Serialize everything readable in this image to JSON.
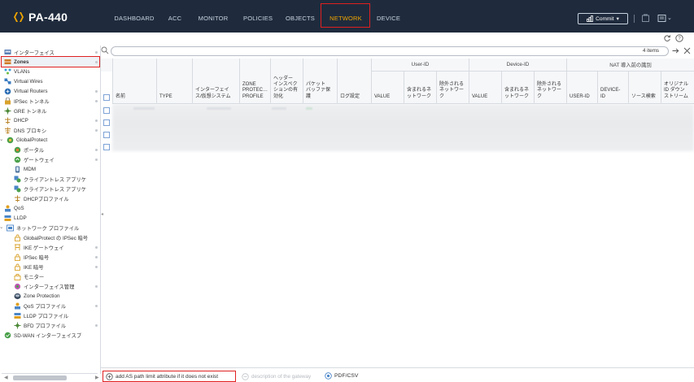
{
  "header": {
    "product": "PA-440",
    "tabs": [
      {
        "label": "DASHBOARD"
      },
      {
        "label": "ACC"
      },
      {
        "label": "MONITOR"
      },
      {
        "label": "POLICIES"
      },
      {
        "label": "OBJECTS"
      },
      {
        "label": "NETWORK",
        "active": true
      },
      {
        "label": "DEVICE"
      }
    ],
    "commit_label": "Commit",
    "active_color": "#f0a500",
    "bar_color": "#1f2b3d"
  },
  "sidebar": {
    "items": [
      {
        "label": "インターフェイス",
        "icon": "interface-icon"
      },
      {
        "label": "Zones",
        "icon": "zone-icon",
        "selected": true
      },
      {
        "label": "VLANs",
        "icon": "vlan-icon"
      },
      {
        "label": "Virtual Wires",
        "icon": "virtual-wire-icon"
      },
      {
        "label": "Virtual Routers",
        "icon": "virtual-router-icon"
      },
      {
        "label": "IPSec トンネル",
        "icon": "ipsec-tunnel-icon"
      },
      {
        "label": "GRE トンネル",
        "icon": "gre-tunnel-icon"
      },
      {
        "label": "DHCP",
        "icon": "dhcp-icon"
      },
      {
        "label": "DNS プロキシ",
        "icon": "dns-proxy-icon"
      },
      {
        "label": "GlobalProtect",
        "icon": "globalprotect-icon",
        "expanded": true
      },
      {
        "label": "ポータル",
        "icon": "portal-icon"
      },
      {
        "label": "ゲートウェイ",
        "icon": "gateway-icon"
      },
      {
        "label": "MDM",
        "icon": "mdm-icon"
      },
      {
        "label": "クライアントレス アプリケ",
        "icon": "clientless-app-icon"
      },
      {
        "label": "クライアントレス アプリケ",
        "icon": "clientless-app-group-icon"
      },
      {
        "label": "DHCPプロファイル",
        "icon": "dhcp-profile-icon"
      },
      {
        "label": "QoS",
        "icon": "qos-icon"
      },
      {
        "label": "LLDP",
        "icon": "lldp-icon"
      },
      {
        "label": "ネットワーク プロファイル",
        "icon": "network-profiles-icon",
        "expanded": true
      },
      {
        "label": "GlobalProtect の IPSec 暗号",
        "icon": "gp-ipsec-crypto-icon"
      },
      {
        "label": "IKE ゲートウェイ",
        "icon": "ike-gateway-icon"
      },
      {
        "label": "IPSec 暗号",
        "icon": "ipsec-crypto-icon"
      },
      {
        "label": "IKE 暗号",
        "icon": "ike-crypto-icon"
      },
      {
        "label": "モニター",
        "icon": "monitor-profile-icon"
      },
      {
        "label": "インターフェイス管理",
        "icon": "interface-mgmt-icon"
      },
      {
        "label": "Zone Protection",
        "icon": "zone-protection-icon"
      },
      {
        "label": "QoS プロファイル",
        "icon": "qos-profile-icon"
      },
      {
        "label": "LLDP プロファイル",
        "icon": "lldp-profile-icon"
      },
      {
        "label": "BFD プロファイル",
        "icon": "bfd-profile-icon"
      },
      {
        "label": "SD-WAN インターフェイスプ",
        "icon": "sdwan-interface-icon"
      }
    ]
  },
  "search": {
    "value": "",
    "placeholder": "",
    "items_count": "4 items"
  },
  "table": {
    "group_headers": {
      "user_id": "User-ID",
      "device_id": "Device-ID",
      "nat": "NAT 導入前の識別"
    },
    "columns": {
      "name": "名前",
      "type": "TYPE",
      "interfaces": [
        "インターフェイ",
        "ス/仮想システム"
      ],
      "zone_protection": [
        "ZONE",
        "PROTEC…",
        "PROFILE"
      ],
      "header_inspection": [
        "ヘッダー",
        "インスペク",
        "ションの有",
        "効化"
      ],
      "packet_buffer": [
        "パケット",
        "バッファ保",
        "護"
      ],
      "log_setting": "ログ設定",
      "user_value": "VALUE",
      "user_include": [
        "含まれるネ",
        "ットワーク"
      ],
      "user_exclude": [
        "除外される",
        "ネットワー",
        "ク"
      ],
      "device_value": "VALUE",
      "device_include": [
        "含まれるネ",
        "ットワーク"
      ],
      "device_exclude": [
        "除外される",
        "ネットワー",
        "ク"
      ],
      "nat_user_id": "USER-ID",
      "nat_device_id": [
        "DEVICE-",
        "ID"
      ],
      "nat_source": "ソース検索",
      "nat_downstream": [
        "オリジナル",
        "ID ダウン",
        "ストリーム"
      ]
    },
    "row_count": 4
  },
  "footer": {
    "add_label": "add AS path limit attribute if it does not exist",
    "delete_label": "description of the gateway",
    "pdf_label": "PDF/CSV"
  }
}
